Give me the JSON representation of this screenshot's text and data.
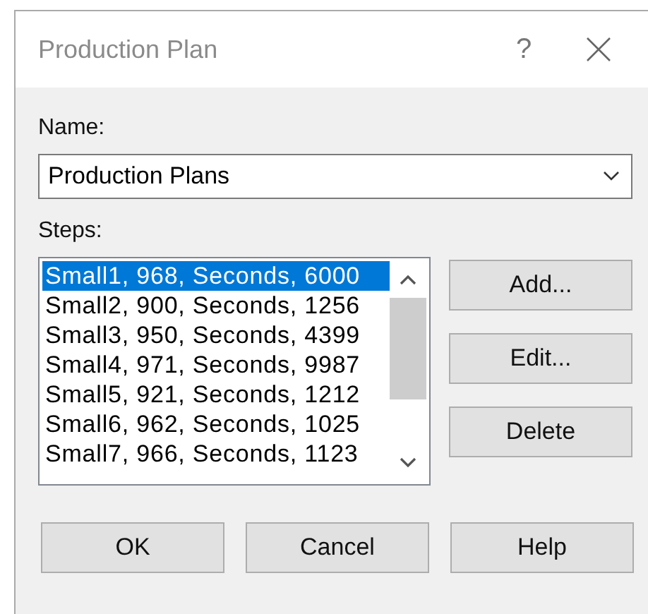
{
  "window": {
    "title": "Production Plan",
    "help_glyph": "?"
  },
  "name_field": {
    "label": "Name:",
    "value": "Production Plans"
  },
  "steps": {
    "label": "Steps:",
    "items": [
      {
        "text": "Small1, 968, Seconds, 6000",
        "selected": true
      },
      {
        "text": "Small2, 900, Seconds, 1256",
        "selected": false
      },
      {
        "text": "Small3, 950, Seconds, 4399",
        "selected": false
      },
      {
        "text": "Small4, 971, Seconds, 9987",
        "selected": false
      },
      {
        "text": "Small5, 921, Seconds, 1212",
        "selected": false
      },
      {
        "text": "Small6, 962, Seconds, 1025",
        "selected": false
      },
      {
        "text": "Small7, 966, Seconds, 1123",
        "selected": false
      }
    ]
  },
  "side_buttons": [
    "Add...",
    "Edit...",
    "Delete"
  ],
  "buttons": [
    "OK",
    "Cancel",
    "Help"
  ]
}
